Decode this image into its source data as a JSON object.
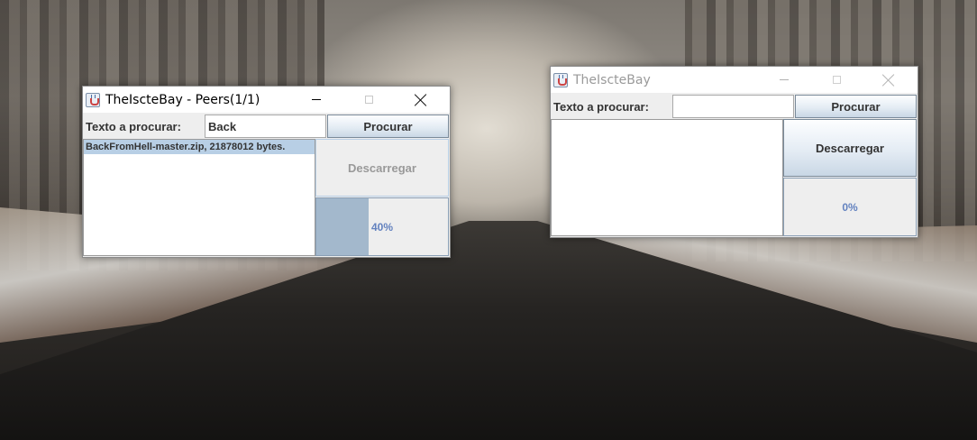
{
  "windows": [
    {
      "title": "TheIscteBay - Peers(1/1)",
      "search_label": "Texto a procurar:",
      "search_value": "Back",
      "search_button": "Procurar",
      "results": [
        "BackFromHell-master.zip, 21878012 bytes."
      ],
      "download_button": "Descarregar",
      "download_enabled": false,
      "progress_text": "40%",
      "progress_value": 0.4
    },
    {
      "title": "TheIscteBay",
      "search_label": "Texto a procurar:",
      "search_value": "",
      "search_button": "Procurar",
      "results": [],
      "download_button": "Descarregar",
      "download_enabled": true,
      "progress_text": "0%",
      "progress_value": 0.0
    }
  ]
}
